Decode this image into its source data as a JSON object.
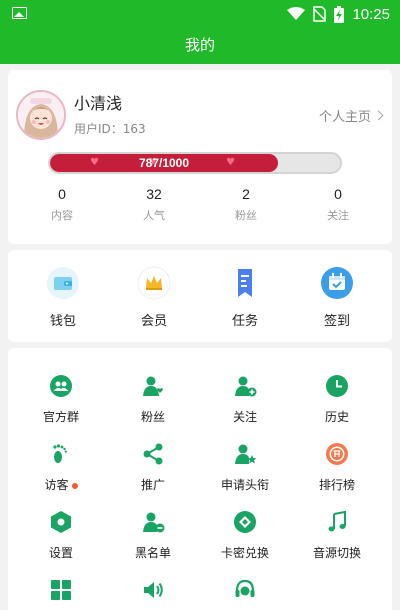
{
  "status_bar": {
    "time": "10:25"
  },
  "header": {
    "title": "我的"
  },
  "profile": {
    "username": "小清浅",
    "user_id": "用户ID：163",
    "homepage_link": "个人主页",
    "level_progress": {
      "text": "787/1000",
      "current": 787,
      "max": 1000
    },
    "stats": [
      {
        "value": "0",
        "label": "内容"
      },
      {
        "value": "32",
        "label": "人气"
      },
      {
        "value": "2",
        "label": "粉丝"
      },
      {
        "value": "0",
        "label": "关注"
      }
    ]
  },
  "quick_actions": [
    {
      "label": "钱包",
      "icon": "wallet-icon"
    },
    {
      "label": "会员",
      "icon": "crown-icon"
    },
    {
      "label": "任务",
      "icon": "task-ribbon-icon"
    },
    {
      "label": "签到",
      "icon": "calendar-check-icon"
    }
  ],
  "grid_menu": [
    {
      "label": "官方群",
      "icon": "group-icon"
    },
    {
      "label": "粉丝",
      "icon": "fans-icon"
    },
    {
      "label": "关注",
      "icon": "add-user-icon"
    },
    {
      "label": "历史",
      "icon": "clock-icon"
    },
    {
      "label": "访客",
      "icon": "footprint-icon",
      "badge_dot": true
    },
    {
      "label": "推广",
      "icon": "share-icon"
    },
    {
      "label": "申请头衔",
      "icon": "user-star-icon"
    },
    {
      "label": "排行榜",
      "icon": "rank-icon"
    },
    {
      "label": "设置",
      "icon": "settings-hexagon-icon"
    },
    {
      "label": "黑名单",
      "icon": "user-minus-icon"
    },
    {
      "label": "卡密兑换",
      "icon": "redeem-icon"
    },
    {
      "label": "音源切换",
      "icon": "music-note-icon"
    },
    {
      "label": "",
      "icon": "grid-apps-icon"
    },
    {
      "label": "",
      "icon": "speaker-icon"
    },
    {
      "label": "",
      "icon": "headset-service-icon"
    }
  ],
  "colors": {
    "brand_green": "#1fb92a",
    "icon_green": "#19a463",
    "progress_red": "#c41e3a",
    "badge_orange": "#f15a2b"
  }
}
